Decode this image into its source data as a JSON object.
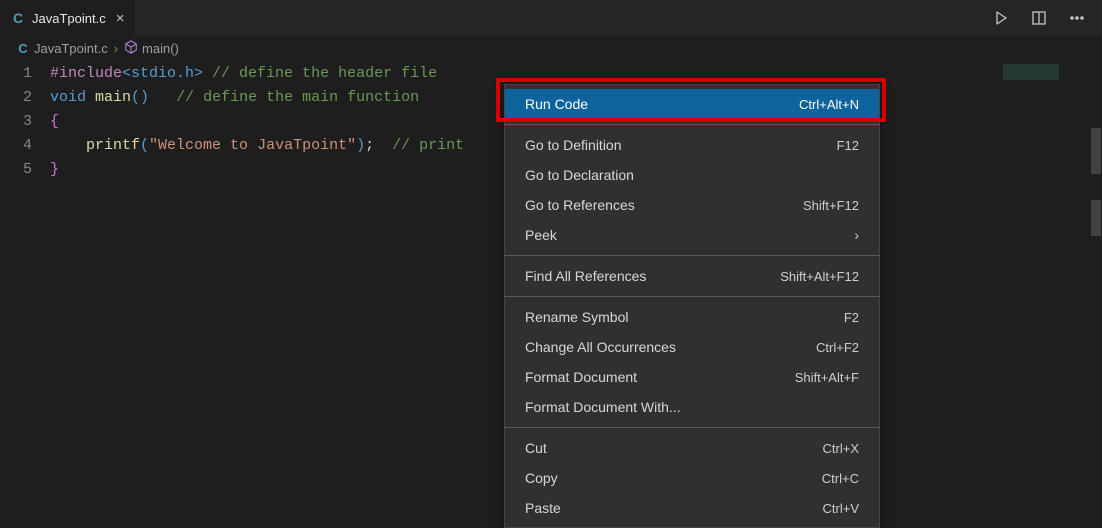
{
  "tab": {
    "label": "JavaTpoint.c",
    "lang_icon": "C"
  },
  "toolbar_icons": {
    "run": "run-icon",
    "split": "split-editor-icon",
    "more": "more-icon"
  },
  "breadcrumb": {
    "file_icon": "C",
    "file": "JavaTpoint.c",
    "symbol_icon": "cube",
    "symbol": "main()"
  },
  "code_lines": [
    {
      "n": "1",
      "html": "<span class='tok-directive'>#include</span><span class='tok-angle'>&lt;stdio.h&gt;</span> <span class='tok-comment'>// define the header file</span>"
    },
    {
      "n": "2",
      "html": "<span class='tok-keyword'>void</span> <span class='tok-func'>main</span><span class='tok-paren'>()</span>   <span class='tok-comment'>// define the main function</span>"
    },
    {
      "n": "3",
      "html": "<span class='tok-brace'>{</span>"
    },
    {
      "n": "4",
      "html": "    <span class='tok-func'>printf</span><span class='tok-paren'>(</span><span class='tok-string'>\"Welcome to JavaTpoint\"</span><span class='tok-paren'>)</span>;  <span class='tok-comment'>// print</span>"
    },
    {
      "n": "5",
      "html": "<span class='tok-brace'>}</span>"
    }
  ],
  "context_menu": [
    {
      "type": "item",
      "label": "Run Code",
      "shortcut": "Ctrl+Alt+N",
      "highlight": true
    },
    {
      "type": "sep"
    },
    {
      "type": "item",
      "label": "Go to Definition",
      "shortcut": "F12"
    },
    {
      "type": "item",
      "label": "Go to Declaration",
      "shortcut": ""
    },
    {
      "type": "item",
      "label": "Go to References",
      "shortcut": "Shift+F12"
    },
    {
      "type": "item",
      "label": "Peek",
      "shortcut": "",
      "submenu": true
    },
    {
      "type": "sep"
    },
    {
      "type": "item",
      "label": "Find All References",
      "shortcut": "Shift+Alt+F12"
    },
    {
      "type": "sep"
    },
    {
      "type": "item",
      "label": "Rename Symbol",
      "shortcut": "F2"
    },
    {
      "type": "item",
      "label": "Change All Occurrences",
      "shortcut": "Ctrl+F2"
    },
    {
      "type": "item",
      "label": "Format Document",
      "shortcut": "Shift+Alt+F"
    },
    {
      "type": "item",
      "label": "Format Document With...",
      "shortcut": ""
    },
    {
      "type": "sep"
    },
    {
      "type": "item",
      "label": "Cut",
      "shortcut": "Ctrl+X"
    },
    {
      "type": "item",
      "label": "Copy",
      "shortcut": "Ctrl+C"
    },
    {
      "type": "item",
      "label": "Paste",
      "shortcut": "Ctrl+V"
    }
  ]
}
